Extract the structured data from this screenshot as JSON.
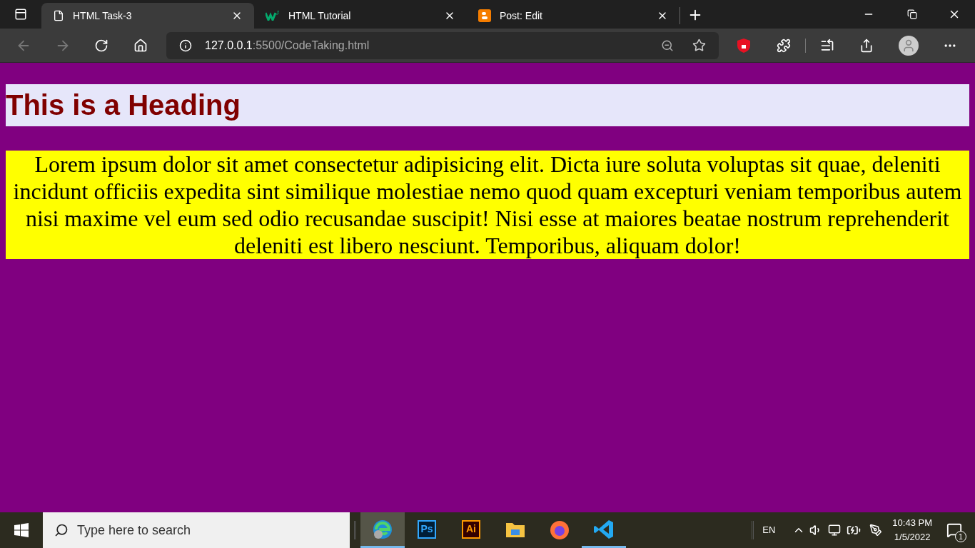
{
  "tabs": [
    {
      "title": "HTML Task-3",
      "kind": "page",
      "selected": true
    },
    {
      "title": "HTML Tutorial",
      "kind": "w3",
      "selected": false
    },
    {
      "title": "Post: Edit",
      "kind": "blogger",
      "selected": false
    }
  ],
  "address": {
    "host": "127.0.0.1",
    "rest": ":5500/CodeTaking.html"
  },
  "page": {
    "heading": "This is a Heading",
    "paragraph": "Lorem ipsum dolor sit amet consectetur adipisicing elit. Dicta iure soluta voluptas sit quae, deleniti incidunt officiis expedita sint similique molestiae nemo quod quam excepturi veniam temporibus autem nisi maxime vel eum sed odio recusandae suscipit! Nisi esse at maiores beatae nostrum reprehenderit deleniti est libero nesciunt. Temporibus, aliquam dolor!"
  },
  "taskbar": {
    "search_placeholder": "Type here to search",
    "apps": [
      {
        "kind": "edge",
        "selected": true,
        "running": true
      },
      {
        "kind": "ps",
        "label": "Ps",
        "selected": false,
        "running": false
      },
      {
        "kind": "ai",
        "label": "Ai",
        "selected": false,
        "running": false
      },
      {
        "kind": "folder",
        "selected": false,
        "running": false
      },
      {
        "kind": "firefox",
        "selected": false,
        "running": false
      },
      {
        "kind": "vscode",
        "selected": false,
        "running": true
      }
    ],
    "language": "EN",
    "time": "10:43 PM",
    "date": "1/5/2022",
    "notifications": "1"
  }
}
